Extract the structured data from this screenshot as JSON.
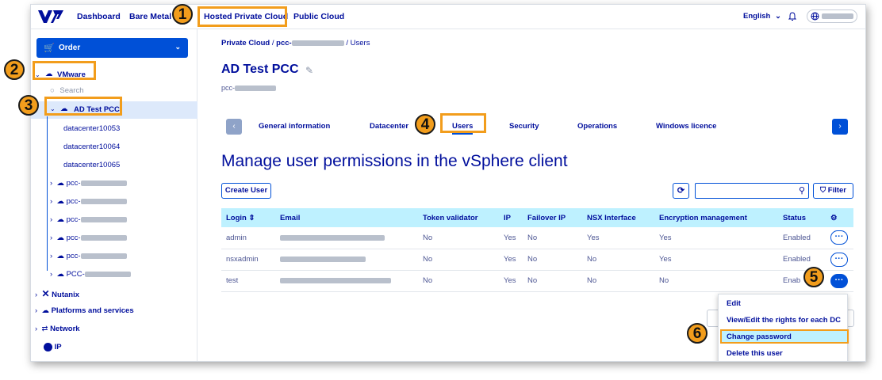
{
  "topnav": {
    "links": [
      "Dashboard",
      "Bare Metal",
      "Hosted Private Cloud",
      "Public Cloud"
    ],
    "language": "English",
    "language_chevron": "⌄",
    "bell": "♫"
  },
  "sidebar": {
    "order_label": "Order",
    "order_icon": "🛒",
    "vmware_label": "VMware",
    "search_placeholder": "Search",
    "selected_label": "AD Test PCC",
    "datacenters": [
      "datacenter10053",
      "datacenter10064",
      "datacenter10065"
    ],
    "pcc_prefix": [
      "pcc-",
      "pcc-",
      "pcc-",
      "pcc-",
      "pcc-",
      "PCC-"
    ],
    "bottom_items": [
      "Nutanix",
      "Platforms and services",
      "Network",
      "IP"
    ]
  },
  "breadcrumb": {
    "root": "Private Cloud",
    "sep": "/",
    "middle": "pcc-",
    "last": "Users"
  },
  "page": {
    "title": "AD Test PCC",
    "subtitle": "pcc-",
    "heading": "Manage user permissions in the vSphere client"
  },
  "tabs": [
    "General information",
    "Datacenter",
    "Users",
    "Security",
    "Operations",
    "Windows licence"
  ],
  "toolbar": {
    "create_user": "Create User",
    "filter": "Filter"
  },
  "table": {
    "columns": [
      "Login",
      "Email",
      "Token validator",
      "IP",
      "Failover IP",
      "NSX Interface",
      "Encryption management",
      "Status"
    ],
    "rows": [
      {
        "login": "admin",
        "token": "No",
        "ip": "Yes",
        "failover": "No",
        "nsx": "Yes",
        "encryption": "Yes",
        "status": "Enabled"
      },
      {
        "login": "nsxadmin",
        "token": "No",
        "ip": "Yes",
        "failover": "No",
        "nsx": "No",
        "encryption": "Yes",
        "status": "Enabled"
      },
      {
        "login": "test",
        "token": "No",
        "ip": "Yes",
        "failover": "No",
        "nsx": "No",
        "encryption": "No",
        "status": "Enab"
      }
    ]
  },
  "context_menu": {
    "items": [
      "Edit",
      "View/Edit the rights for each DC",
      "Change password",
      "Delete this user"
    ]
  },
  "annotations": {
    "numbers": [
      "1",
      "2",
      "3",
      "4",
      "5",
      "6"
    ],
    "color": "#f29d1c"
  },
  "colors": {
    "brand": "#000e9c",
    "accent": "#0050d7",
    "table_header": "#bef1ff"
  }
}
